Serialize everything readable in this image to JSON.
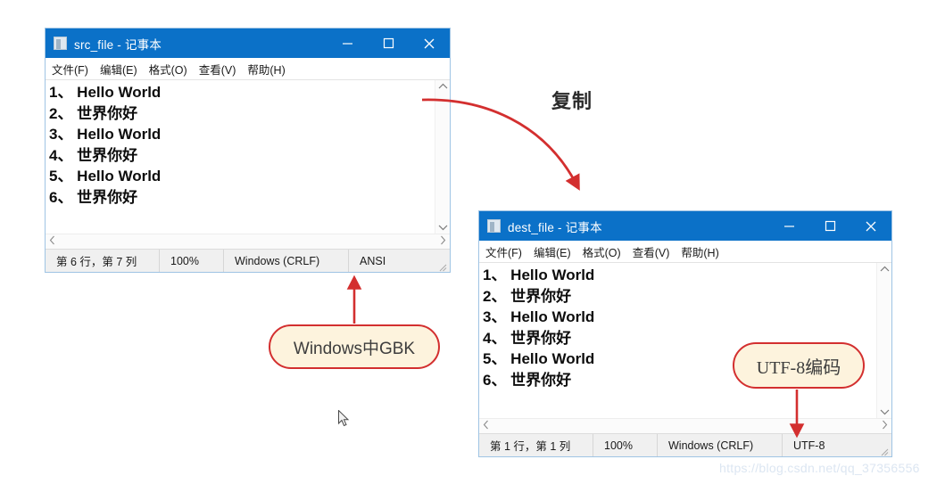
{
  "windows": [
    {
      "id": "src",
      "title": "src_file - 记事本",
      "app_icon": "notepad-icon",
      "window_controls": {
        "minimize": "minimize-icon",
        "maximize": "maximize-icon",
        "close": "close-icon"
      },
      "menu": [
        "文件(F)",
        "编辑(E)",
        "格式(O)",
        "查看(V)",
        "帮助(H)"
      ],
      "content_lines": [
        "1、 Hello World",
        "2、 世界你好",
        "3、 Hello World",
        "4、 世界你好",
        "5、 Hello World",
        "6、 世界你好"
      ],
      "status": {
        "position": "第 6 行，第 7 列",
        "zoom": "100%",
        "line_ending": "Windows (CRLF)",
        "encoding": "ANSI"
      }
    },
    {
      "id": "dest",
      "title": "dest_file - 记事本",
      "app_icon": "notepad-icon",
      "window_controls": {
        "minimize": "minimize-icon",
        "maximize": "maximize-icon",
        "close": "close-icon"
      },
      "menu": [
        "文件(F)",
        "编辑(E)",
        "格式(O)",
        "查看(V)",
        "帮助(H)"
      ],
      "content_lines": [
        "1、 Hello World",
        "2、 世界你好",
        "3、 Hello World",
        "4、 世界你好",
        "5、 Hello World",
        "6、 世界你好"
      ],
      "status": {
        "position": "第 1 行，第 1 列",
        "zoom": "100%",
        "line_ending": "Windows (CRLF)",
        "encoding": "UTF-8"
      }
    }
  ],
  "annotations": {
    "copy_label": "复制",
    "gbk_callout": "Windows中GBK",
    "utf8_callout": "UTF-8编码",
    "accent_color": "#d32f2f",
    "callout_fill": "#fdf3dd"
  },
  "watermark": "https://blog.csdn.net/qq_37356556"
}
